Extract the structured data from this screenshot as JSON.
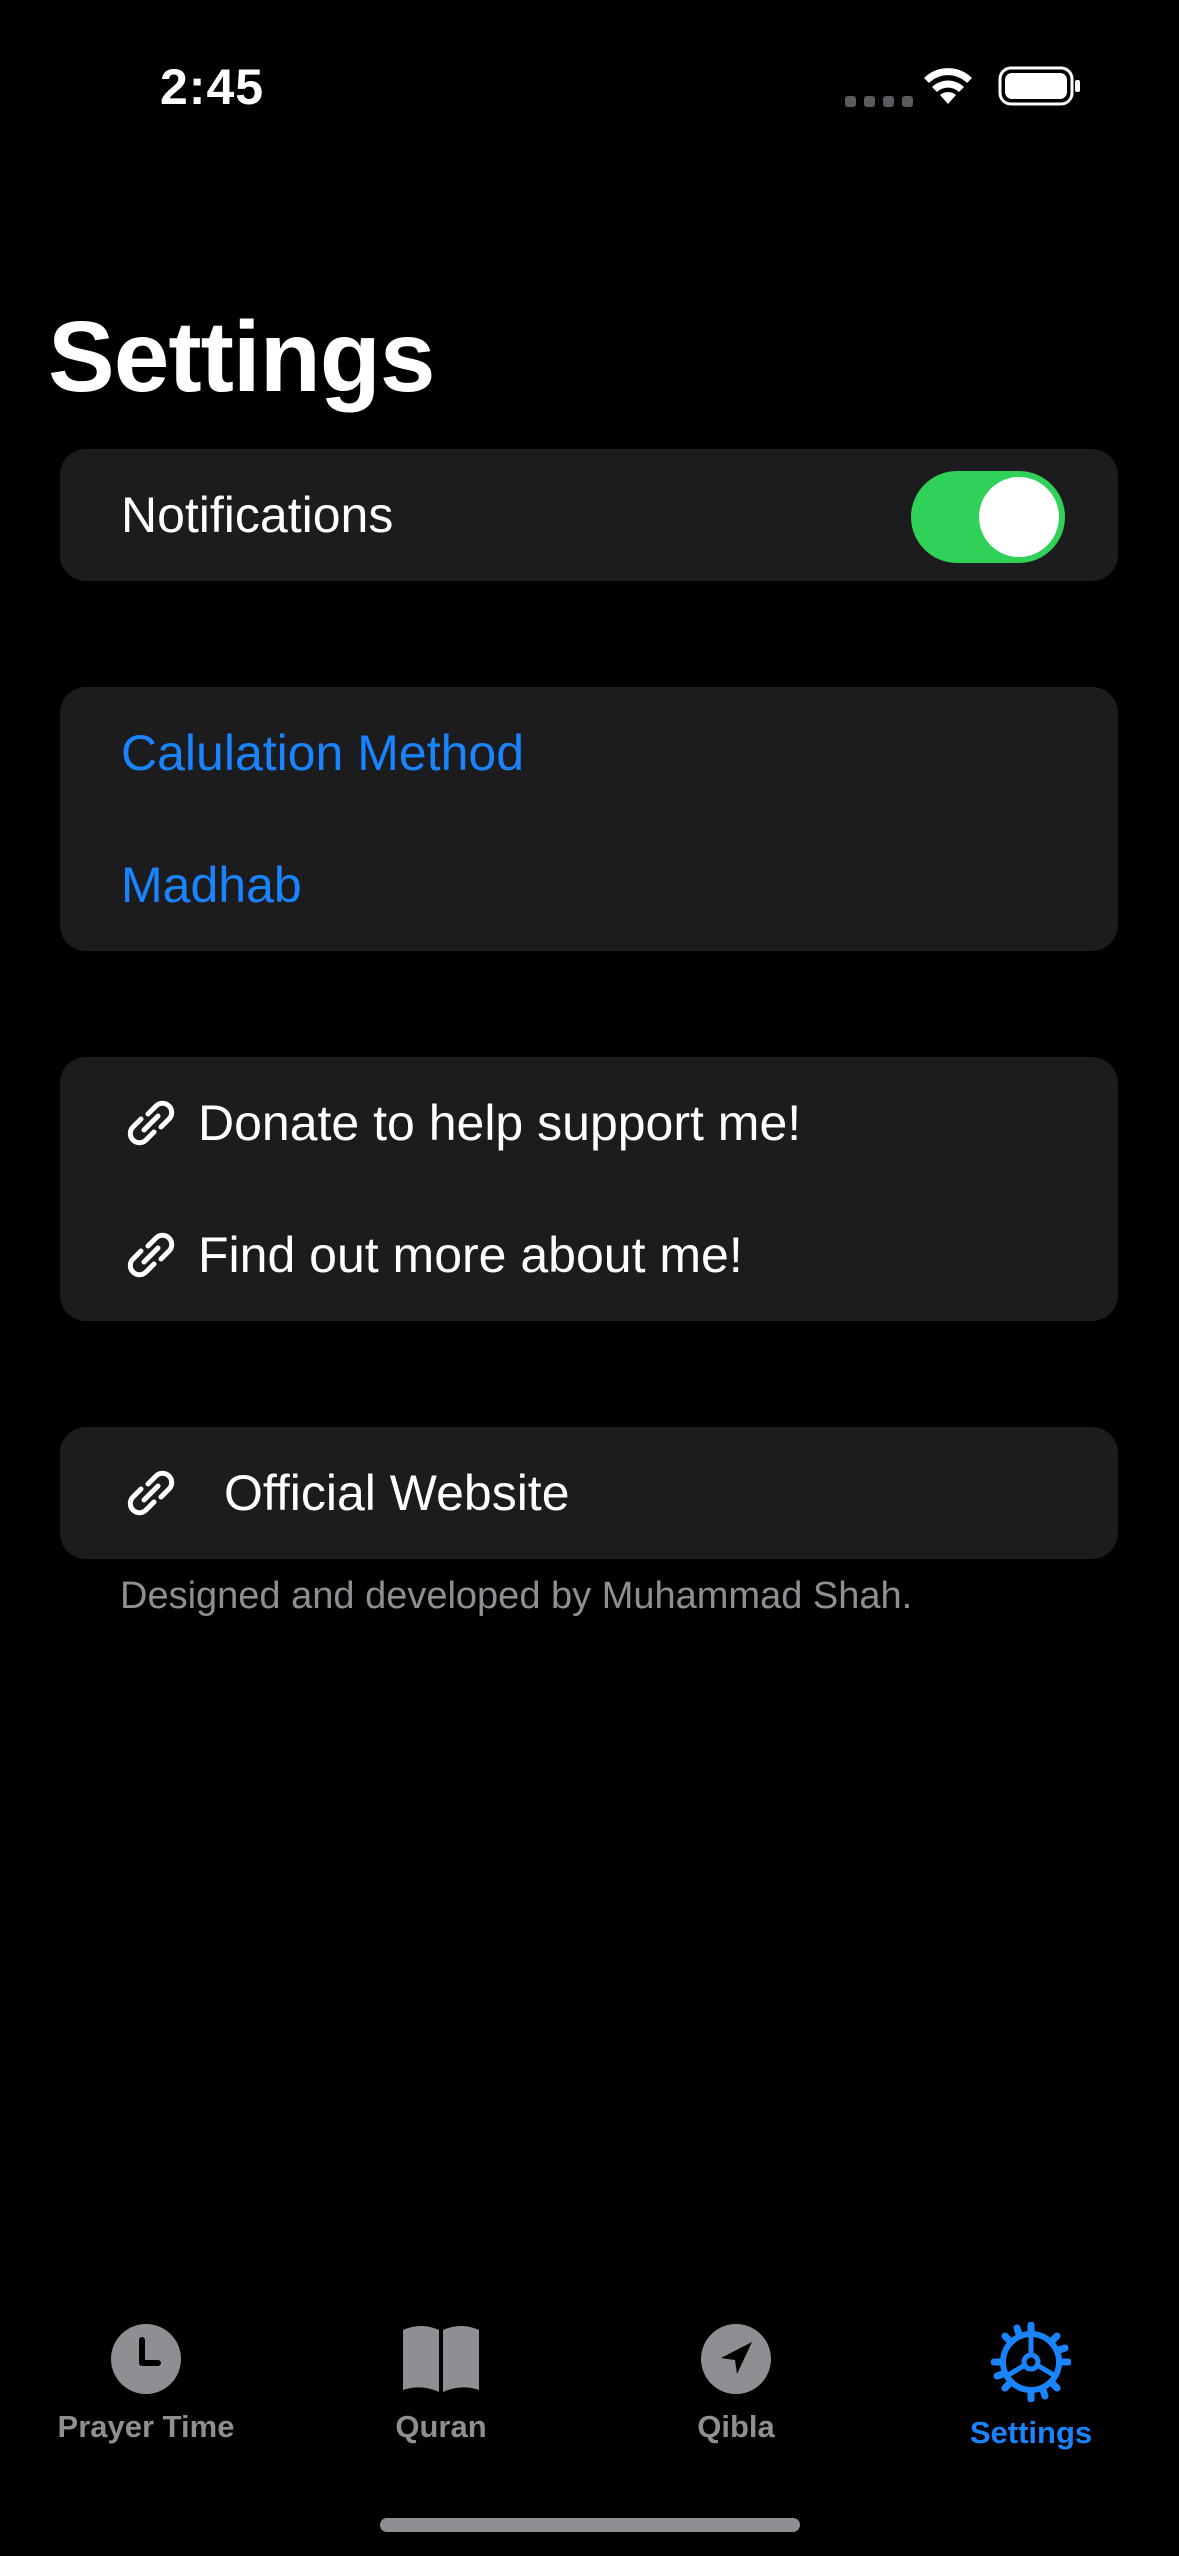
{
  "status_bar": {
    "time": "2:45"
  },
  "page": {
    "title": "Settings"
  },
  "notifications": {
    "label": "Notifications",
    "enabled": true
  },
  "preferences": {
    "items": [
      {
        "label": "Calulation Method"
      },
      {
        "label": "Madhab"
      }
    ]
  },
  "links": {
    "items": [
      {
        "label": "Donate to help support me!",
        "icon": "link-icon"
      },
      {
        "label": "Find out more about me!",
        "icon": "link-icon"
      }
    ]
  },
  "website": {
    "label": "Official Website",
    "icon": "link-icon"
  },
  "footer": {
    "note": "Designed and developed by Muhammad Shah."
  },
  "tabbar": {
    "tabs": [
      {
        "label": "Prayer Time",
        "icon": "clock-icon",
        "active": false
      },
      {
        "label": "Quran",
        "icon": "book-icon",
        "active": false
      },
      {
        "label": "Qibla",
        "icon": "location-arrow-icon",
        "active": false
      },
      {
        "label": "Settings",
        "icon": "gear-icon",
        "active": true
      }
    ]
  },
  "colors": {
    "accent": "#1a84ff",
    "toggle_on": "#30d158",
    "card": "#1c1c1e",
    "muted": "#8e8e93"
  }
}
